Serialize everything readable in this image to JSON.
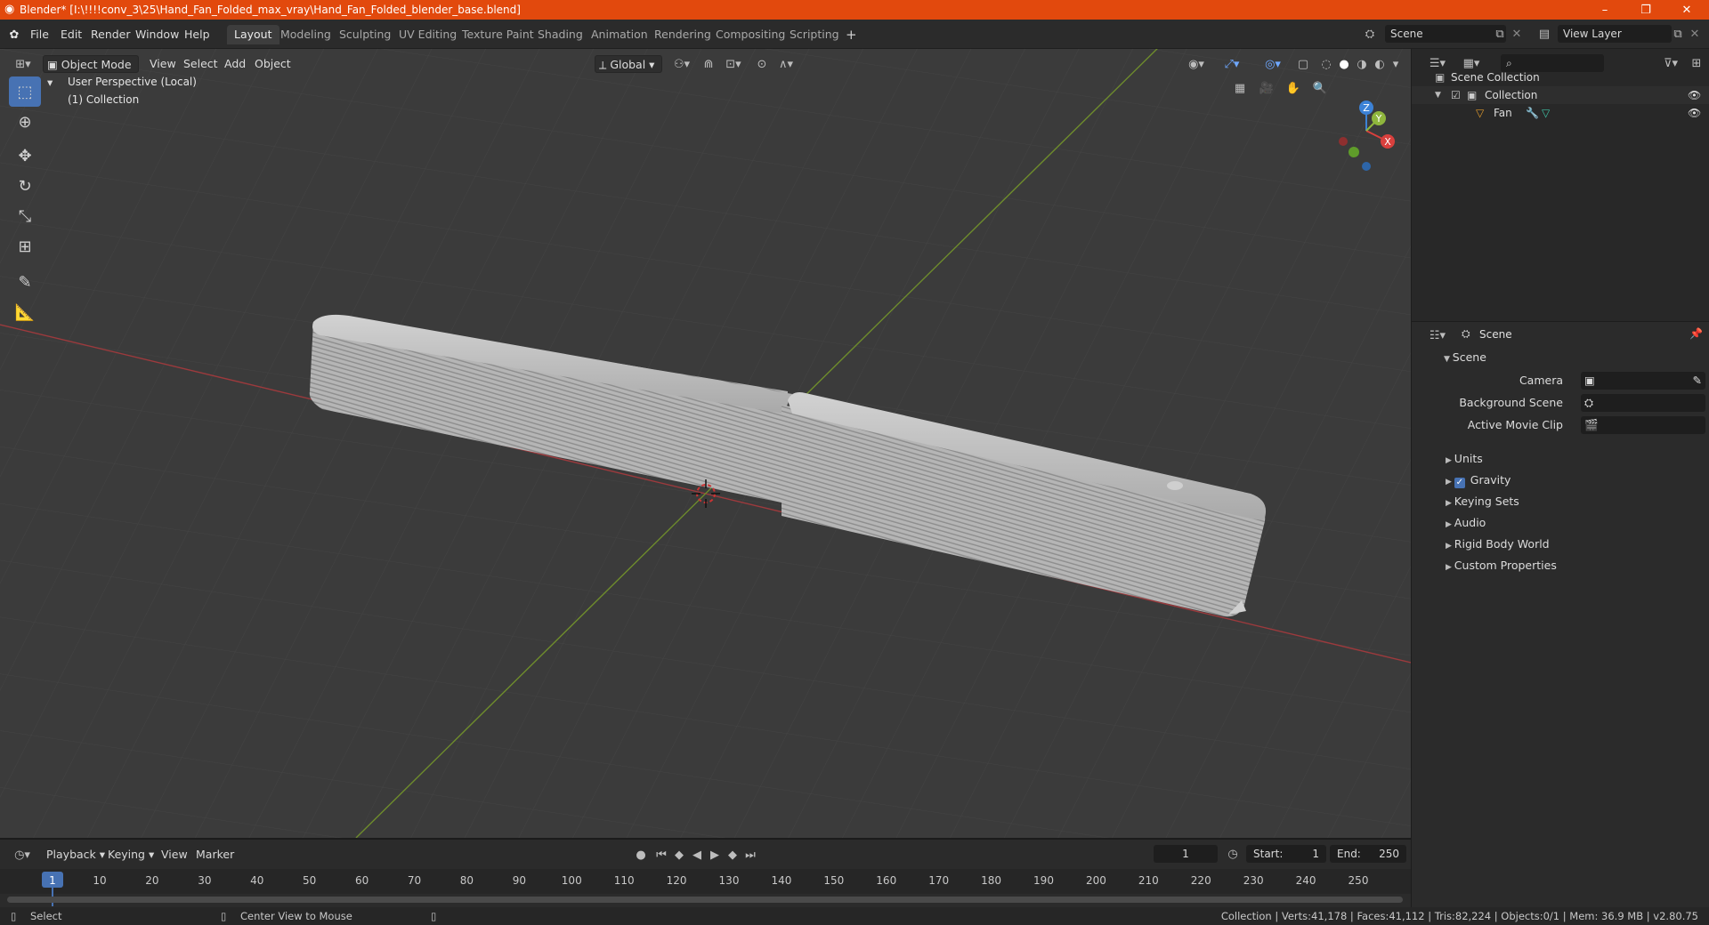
{
  "window": {
    "title": "Blender* [I:\\!!!!conv_3\\25\\Hand_Fan_Folded_max_vray\\Hand_Fan_Folded_blender_base.blend]",
    "minimize": "–",
    "maximize": "❐",
    "close": "✕"
  },
  "menu": [
    "File",
    "Edit",
    "Render",
    "Window",
    "Help"
  ],
  "workspaces": [
    "Layout",
    "Modeling",
    "Sculpting",
    "UV Editing",
    "Texture Paint",
    "Shading",
    "Animation",
    "Rendering",
    "Compositing",
    "Scripting"
  ],
  "active_workspace": "Layout",
  "add_workspace": "+",
  "scene_selector": "Scene",
  "view_layer_selector": "View Layer",
  "viewport": {
    "mode": "Object Mode",
    "menus": [
      "View",
      "Select",
      "Add",
      "Object"
    ],
    "orientation": "Global",
    "overlay_line1": "User Perspective (Local)",
    "overlay_line2": "(1) Collection",
    "axis_labels": {
      "x": "X",
      "y": "Y",
      "z": "Z"
    },
    "object_name": "Fan"
  },
  "outliner": {
    "root": "Scene Collection",
    "collection": "Collection",
    "object": "Fan"
  },
  "properties": {
    "header": "Scene",
    "panel": "Scene",
    "camera_label": "Camera",
    "background_scene_label": "Background Scene",
    "active_movie_clip_label": "Active Movie Clip",
    "sections": [
      "Units",
      "Gravity",
      "Keying Sets",
      "Audio",
      "Rigid Body World",
      "Custom Properties"
    ],
    "gravity_checked": true
  },
  "timeline": {
    "menus": [
      "Playback",
      "Keying",
      "View",
      "Marker"
    ],
    "current_frame": "1",
    "start_label": "Start:",
    "start": "1",
    "end_label": "End:",
    "end": "250",
    "ruler": [
      "1",
      "10",
      "20",
      "30",
      "40",
      "50",
      "60",
      "70",
      "80",
      "90",
      "100",
      "110",
      "120",
      "130",
      "140",
      "150",
      "160",
      "170",
      "180",
      "190",
      "200",
      "210",
      "220",
      "230",
      "240",
      "250"
    ]
  },
  "status": {
    "left1": "Select",
    "left2": "Center View to Mouse",
    "right": "Collection | Verts:41,178 | Faces:41,112 | Tris:82,224 | Objects:0/1 | Mem: 36.9 MB | v2.80.75"
  },
  "colors": {
    "titlebar": "#e2490d",
    "accent": "#4772b3",
    "x_axis": "#d9403d",
    "y_axis": "#8fb63d",
    "z_axis": "#3c82d6"
  }
}
